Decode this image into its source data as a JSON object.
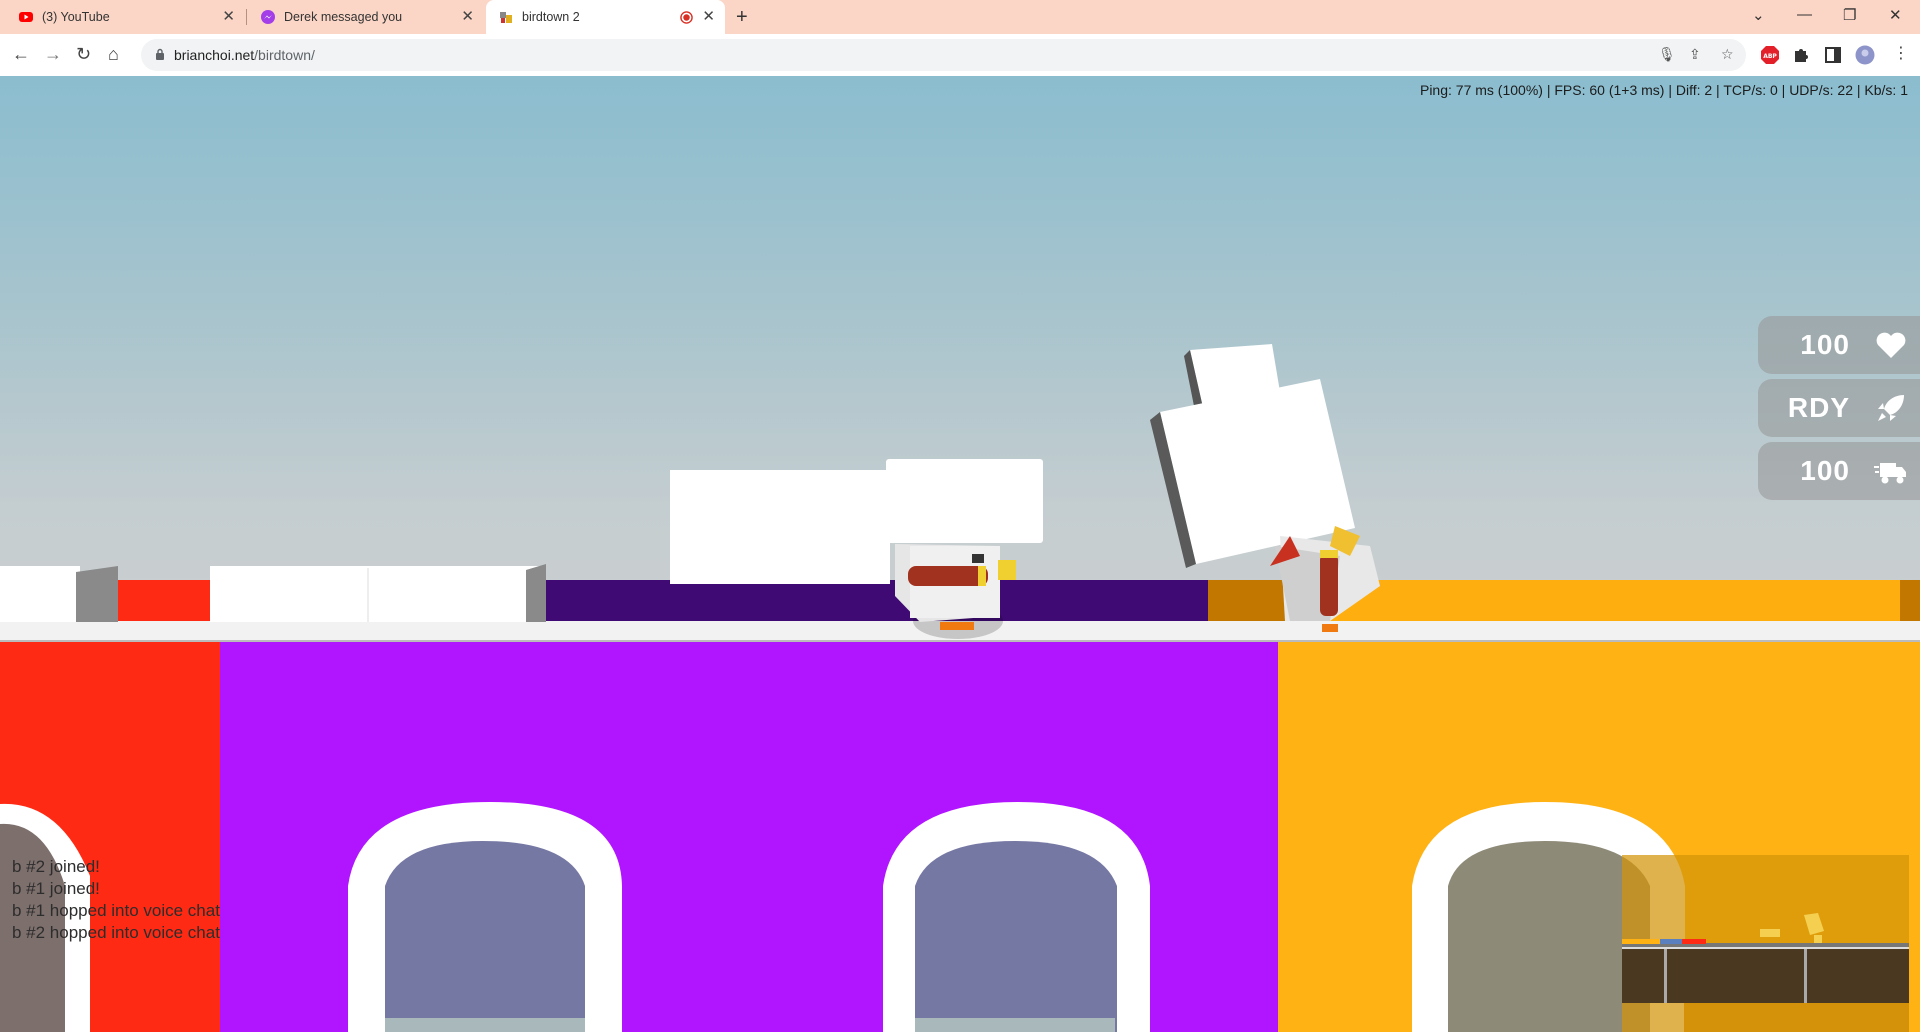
{
  "browser": {
    "tabs": [
      {
        "title": "(3) YouTube",
        "icon": "youtube-icon"
      },
      {
        "title": "Derek messaged you",
        "icon": "messenger-icon"
      },
      {
        "title": "birdtown 2",
        "icon": "birdtown-icon",
        "active": true,
        "recording": true
      }
    ],
    "url": {
      "domain": "brianchoi.net",
      "path": "/birdtown/"
    }
  },
  "game": {
    "debug": "Ping: 77 ms (100%) | FPS: 60 (1+3 ms) | Diff: 2 | TCP/s: 0 | UDP/s: 22 | Kb/s: 1",
    "hud": [
      {
        "value": "100",
        "icon": "heart-icon"
      },
      {
        "value": "RDY",
        "icon": "rocket-icon"
      },
      {
        "value": "100",
        "icon": "truck-icon"
      }
    ],
    "chat": [
      "b #2 joined!",
      "b #1 joined!",
      "b #1 hopped into voice chat",
      "b #2 hopped into voice chat"
    ],
    "colors": {
      "red": "#ff2a14",
      "purple": "#b114ff",
      "orange": "#ffb214",
      "sky": "#8bbdcf"
    }
  }
}
